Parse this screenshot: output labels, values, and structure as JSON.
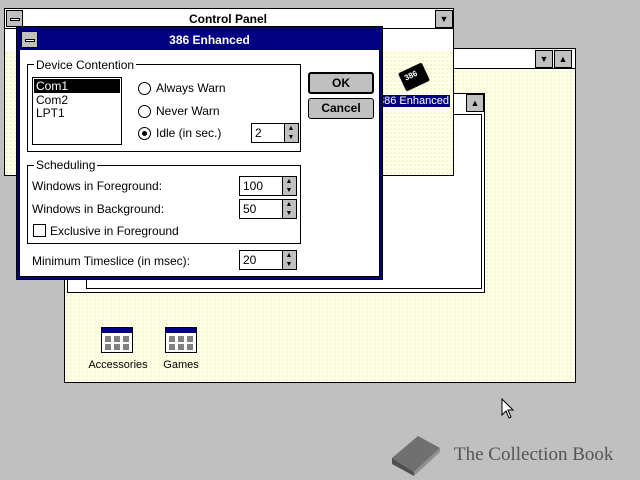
{
  "control_panel": {
    "title": "Control Panel",
    "icon_label": "386 Enhanced"
  },
  "program_manager": {
    "groups": [
      {
        "label": "Accessories"
      },
      {
        "label": "Games"
      }
    ]
  },
  "dialog": {
    "title": "386 Enhanced",
    "device_contention": {
      "label": "Device Contention",
      "ports": [
        "Com1",
        "Com2",
        "LPT1"
      ],
      "selected_port": "Com1",
      "options": [
        {
          "label": "Always Warn",
          "selected": false
        },
        {
          "label": "Never Warn",
          "selected": false
        },
        {
          "label": "Idle (in sec.)",
          "selected": true
        }
      ],
      "idle_value": "2"
    },
    "scheduling": {
      "label": "Scheduling",
      "foreground_label": "Windows in Foreground:",
      "foreground_value": "100",
      "background_label": "Windows in Background:",
      "background_value": "50",
      "exclusive_label": "Exclusive in Foreground",
      "exclusive_checked": false
    },
    "timeslice_label": "Minimum Timeslice (in msec):",
    "timeslice_value": "20",
    "ok_label": "OK",
    "cancel_label": "Cancel"
  },
  "watermark": {
    "text": "The Collection Book"
  }
}
